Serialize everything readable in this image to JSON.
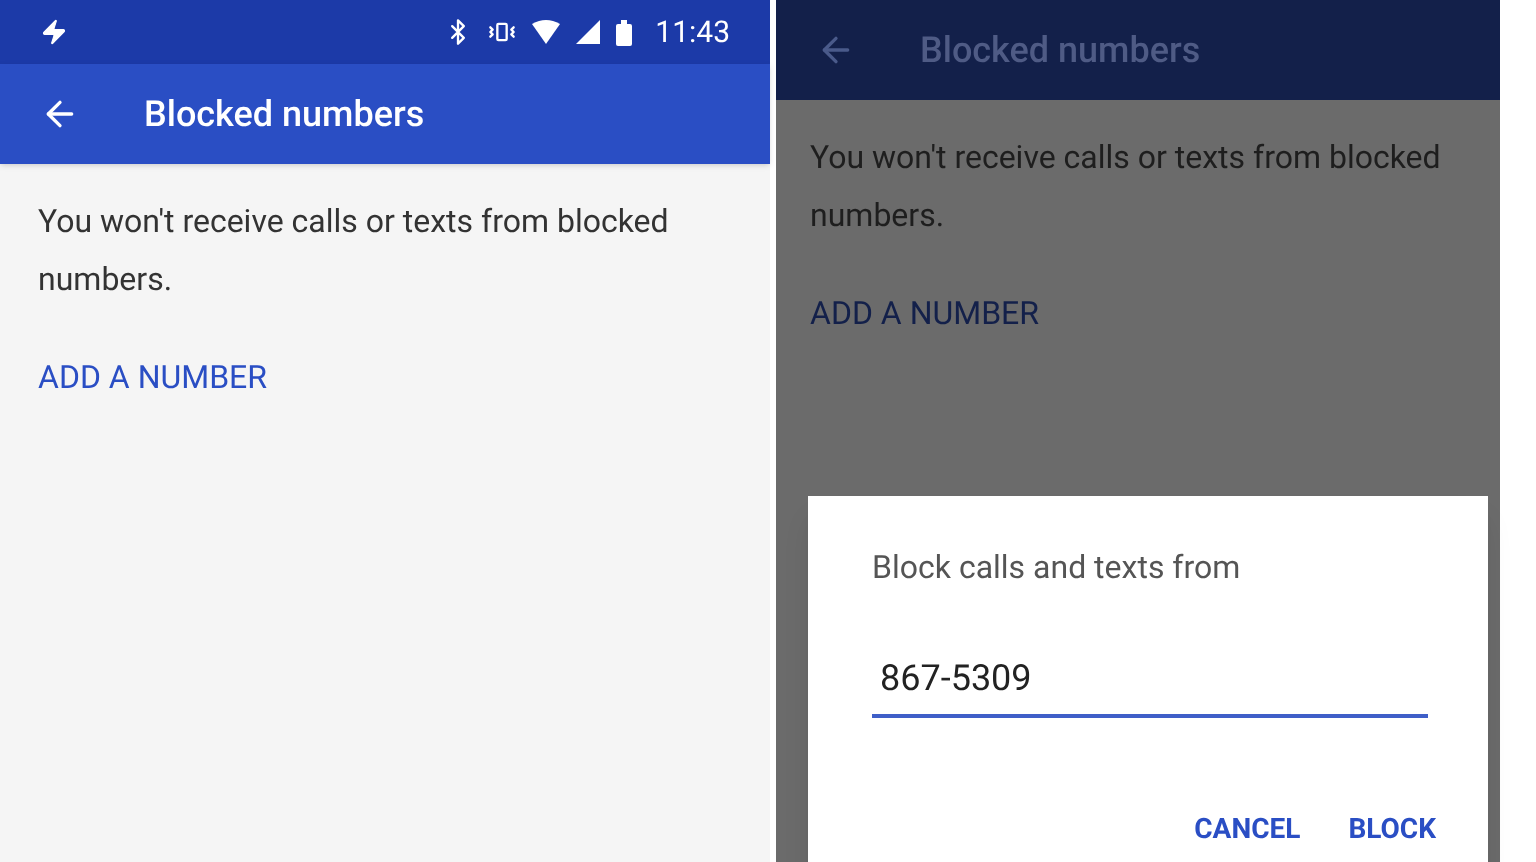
{
  "left_screen": {
    "status_bar": {
      "time": "11:43"
    },
    "toolbar": {
      "title": "Blocked numbers"
    },
    "message": "You won't receive calls or texts from blocked numbers.",
    "add_link": "ADD A NUMBER"
  },
  "right_screen": {
    "toolbar": {
      "title": "Blocked numbers"
    },
    "message": "You won't receive calls or texts from blocked numbers.",
    "add_link": "ADD A NUMBER",
    "dialog": {
      "title": "Block calls and texts from",
      "field_value": "867-5309",
      "buttons": [
        "CANCEL",
        "BLOCK"
      ]
    }
  }
}
